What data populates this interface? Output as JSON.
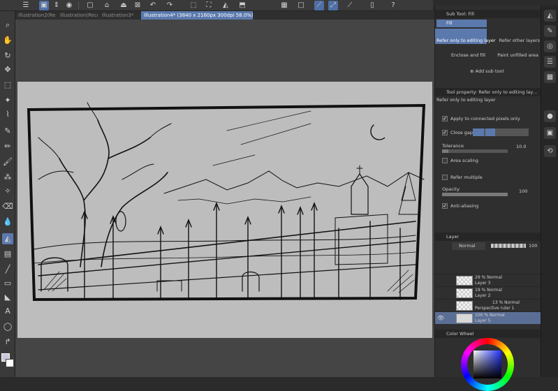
{
  "tabs": [
    {
      "label": "Illustration2(Re…"
    },
    {
      "label": "Illustration(Reco…"
    },
    {
      "label": "Illustration3*"
    },
    {
      "label": "Illustration4* (3840 x 2160px 300dpi 58.0%)"
    }
  ],
  "subtool": {
    "panel_title": "Sub Tool: Fill",
    "group_label": "Fill",
    "items": [
      {
        "label": "Refer only to editing layer"
      },
      {
        "label": "Refer other layers"
      },
      {
        "label": "Enclose and fill"
      },
      {
        "label": "Paint unfilled area"
      }
    ],
    "add_label": "Add sub tool"
  },
  "tool_property": {
    "title": "Tool property: Refer only to editing lay…",
    "subtitle": "Refer only to editing layer",
    "apply_connected": "Apply to connected pixels only",
    "close_gap": "Close gap",
    "tolerance_label": "Tolerance",
    "tolerance_value": "10.0",
    "area_scaling": "Area scaling",
    "refer_multiple": "Refer multiple",
    "opacity_label": "Opacity",
    "opacity_value": "100",
    "anti_aliasing": "Anti-aliasing"
  },
  "layer_panel": {
    "title": "Layer",
    "blend_mode": "Normal",
    "opacity": "100",
    "layers": [
      {
        "opacity_mode": "29 % Normal",
        "name": "Layer 3"
      },
      {
        "opacity_mode": "19 % Normal",
        "name": "Layer 2"
      },
      {
        "opacity_mode": "13 % Normal",
        "name": "Perspective ruler 1"
      },
      {
        "opacity_mode": "100 % Normal",
        "name": "Layer 5"
      }
    ]
  },
  "color_wheel": {
    "title": "Color Wheel"
  },
  "colors": {
    "accent": "#5b79ad",
    "panel_bg": "#2f2f2f",
    "canvas_bg": "#bdbdbd"
  }
}
